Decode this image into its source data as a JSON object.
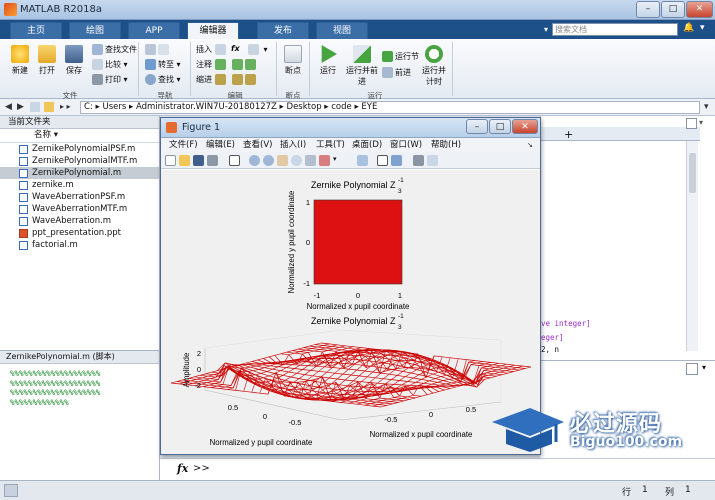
{
  "window": {
    "title": "MATLAB R2018a"
  },
  "ribbon_tabs": [
    "主页",
    "绘图",
    "APP",
    "编辑器",
    "发布",
    "视图"
  ],
  "search": {
    "placeholder": "搜索文档"
  },
  "ribbon": {
    "file": {
      "new": "新建",
      "open": "打开",
      "save": "保存",
      "find_files": "查找文件",
      "compare": "比较",
      "print": "打印",
      "group": "文件"
    },
    "nav": {
      "goto": "转至",
      "find": "查找",
      "group": "导航"
    },
    "edit": {
      "insert": "插入",
      "comment": "注释",
      "indent": "缩进",
      "fx": "fx",
      "group": "编辑"
    },
    "breakpoints": {
      "label": "断点",
      "group": "断点"
    },
    "run": {
      "run": "运行",
      "run_advance": "运行并前进",
      "run_section": "运行节",
      "advance": "前进",
      "run_time": "运行并计时",
      "group": "运行"
    }
  },
  "address": {
    "path": "C: ▸ Users ▸ Administrator.WIN7U-20180127Z ▸ Desktop ▸ code ▸ EYE"
  },
  "left_panel": {
    "title": "当前文件夹",
    "column": "名称",
    "files": [
      {
        "name": "ZernikePolynomialPSF.m",
        "type": "m"
      },
      {
        "name": "ZernikePolynomialMTF.m",
        "type": "m"
      },
      {
        "name": "ZernikePolynomial.m",
        "type": "m",
        "selected": true
      },
      {
        "name": "zernike.m",
        "type": "m"
      },
      {
        "name": "WaveAberrationPSF.m",
        "type": "m"
      },
      {
        "name": "WaveAberrationMTF.m",
        "type": "m"
      },
      {
        "name": "WaveAberration.m",
        "type": "m"
      },
      {
        "name": "ppt_presentation.ppt",
        "type": "p"
      },
      {
        "name": "factorial.m",
        "type": "m"
      }
    ]
  },
  "details": {
    "title": "ZernikePolynomial.m  (脚本)",
    "lines": [
      "%%%%%%%%%%%%%%%%%%%%",
      "%%%%%%%%%%%%%%%%%%%%",
      "%%%%%%%%%%%%%%%%%%%%",
      "%%%%%%%%%%%%%"
    ]
  },
  "editor": {
    "plus": "+",
    "lines": [
      "ve integer]",
      "eger]",
      "2, n"
    ]
  },
  "command": {
    "prompt": ">>",
    "fx": "fx"
  },
  "status": {
    "row_label": "行",
    "row": "1",
    "col_label": "列",
    "col": "1"
  },
  "figure": {
    "title": "Figure 1",
    "menu": [
      "文件(F)",
      "编辑(E)",
      "查看(V)",
      "插入(I)",
      "工具(T)",
      "桌面(D)",
      "窗口(W)",
      "帮助(H)"
    ],
    "top_plot": {
      "title": "Zernike Polynomial  Z",
      "sup": "-1",
      "sub": "3",
      "xlabel": "Normalized x pupil coordinate",
      "ylabel": "Normalized y pupil coordinate",
      "xticks": [
        "-1",
        "0",
        "1"
      ],
      "yticks": [
        "1",
        "0",
        "-1"
      ],
      "color": "#dd1111"
    },
    "bottom_plot": {
      "title": "Zernike Polynomial  Z",
      "sup": "-1",
      "sub": "3",
      "zlabel": "Amplitude",
      "xlabel": "Normalized x pupil coordinate",
      "ylabel": "Normalized y pupil coordinate",
      "zticks": [
        "2",
        "0",
        "-2"
      ],
      "yticks": [
        "0.5",
        "0",
        "-0.5"
      ],
      "xticks": [
        "-0.5",
        "0",
        "0.5"
      ],
      "color": "#cc0000"
    }
  },
  "watermark": {
    "text": "必过源码",
    "url": "Biguo100.com"
  }
}
